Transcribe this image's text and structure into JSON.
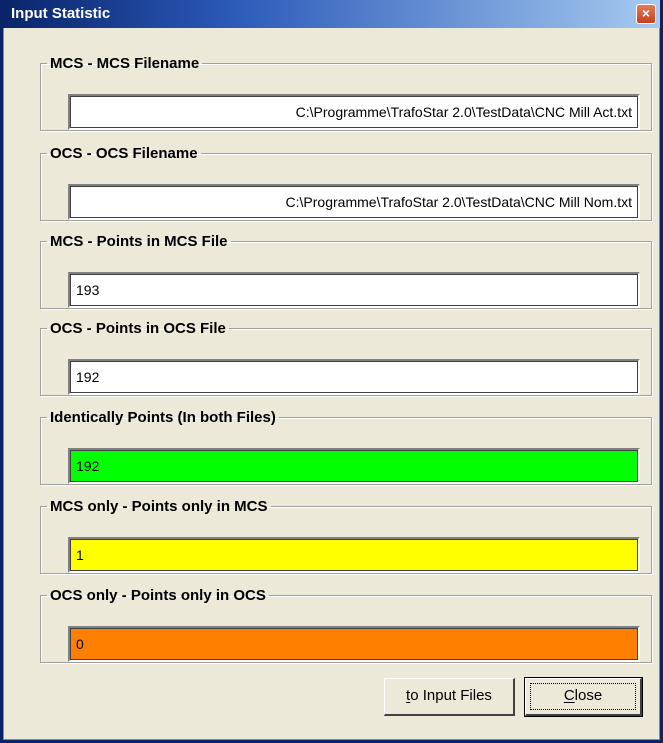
{
  "window": {
    "title": "Input Statistic",
    "close_glyph": "×",
    "close_icon": "close-icon"
  },
  "groups": [
    {
      "legend": "MCS - MCS Filename",
      "value": "C:\\Programme\\TrafoStar 2.0\\TestData\\CNC Mill Act.txt",
      "background": "#ffffff"
    },
    {
      "legend": "OCS - OCS Filename",
      "value": "C:\\Programme\\TrafoStar 2.0\\TestData\\CNC Mill Nom.txt",
      "background": "#ffffff"
    },
    {
      "legend": "MCS - Points in MCS File",
      "value": "193",
      "background": "#ffffff"
    },
    {
      "legend": "OCS - Points in OCS File",
      "value": "192",
      "background": "#ffffff"
    },
    {
      "legend": "Identically Points (In both Files)",
      "value": "192",
      "background": "#00ff00"
    },
    {
      "legend": "MCS only - Points only in MCS",
      "value": "1",
      "background": "#ffff00"
    },
    {
      "legend": "OCS only - Points only in OCS",
      "value": "0",
      "background": "#ff8000"
    }
  ],
  "buttons": {
    "to_input_files": {
      "label_first": "t",
      "label_rest": "o Input Files"
    },
    "close": {
      "label_first": "C",
      "label_rest": "lose"
    }
  }
}
